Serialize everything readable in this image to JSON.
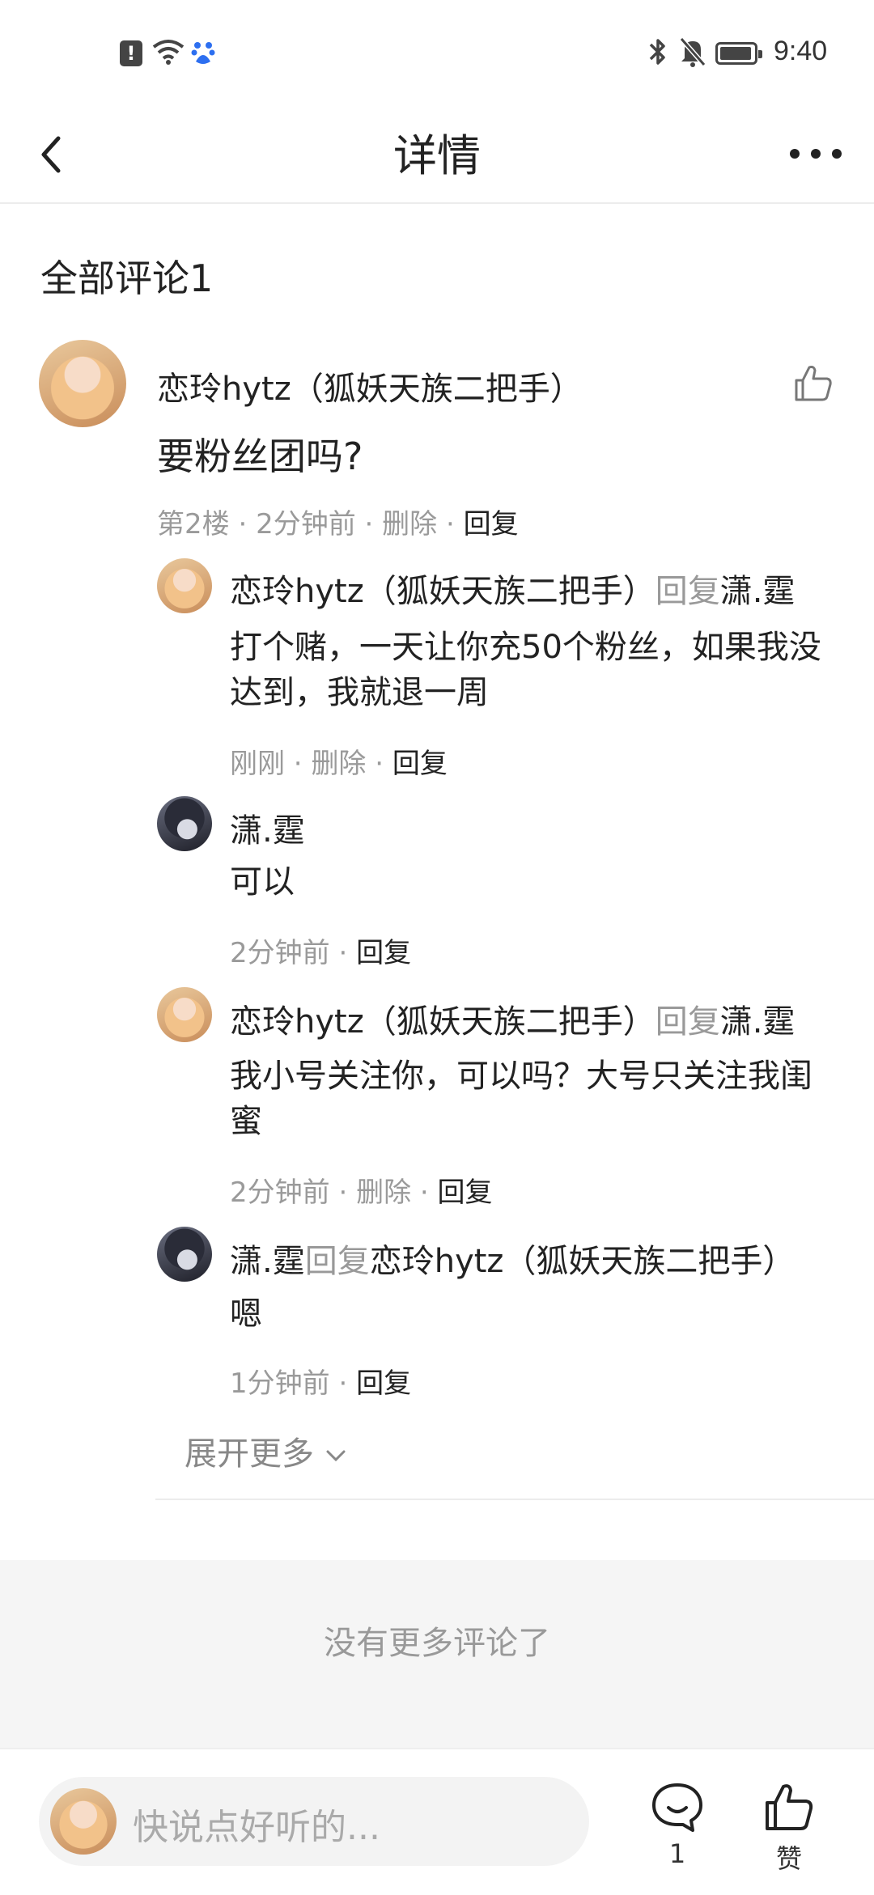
{
  "status_bar": {
    "time": "9:40",
    "alert_glyph": "!"
  },
  "header": {
    "title": "详情"
  },
  "comments": {
    "title": "全部评论1",
    "main": {
      "author": "恋玲hytz（狐妖天族二把手）",
      "text": "要粉丝团吗?",
      "meta_floor": "第2楼",
      "meta_time": "2分钟前",
      "delete": "删除",
      "reply": "回复"
    },
    "replies": [
      {
        "author": "恋玲hytz（狐妖天族二把手）",
        "reply_word": "回复",
        "target": "潇.霆",
        "text": "打个赌，一天让你充50个粉丝，如果我没达到，我就退一周",
        "time": "刚刚",
        "delete": "删除",
        "reply": "回复"
      },
      {
        "author": "潇.霆",
        "text": "可以",
        "time": "2分钟前",
        "reply": "回复"
      },
      {
        "author": "恋玲hytz（狐妖天族二把手）",
        "reply_word": "回复",
        "target": "潇.霆",
        "text": "我小号关注你，可以吗？大号只关注我闺蜜",
        "time": "2分钟前",
        "delete": "删除",
        "reply": "回复"
      },
      {
        "author": "潇.霆",
        "reply_word": "回复",
        "target": "恋玲hytz（狐妖天族二把手）",
        "text": "嗯",
        "time": "1分钟前",
        "reply": "回复"
      }
    ],
    "expand": "展开更多",
    "no_more": "没有更多评论了"
  },
  "bottom_bar": {
    "input_placeholder": "快说点好听的...",
    "comment_count": "1",
    "like_label": "赞"
  },
  "colors": {
    "text": "#222222",
    "muted": "#999999",
    "divider": "#ececec",
    "band": "#f5f5f5"
  },
  "icons": [
    "alert-icon",
    "wifi-icon",
    "baidu-paw-icon",
    "bluetooth-icon",
    "bell-off-icon",
    "battery-icon",
    "back-arrow-icon",
    "more-icon",
    "thumbs-up-icon",
    "comment-bubble-icon",
    "chevron-down-icon"
  ]
}
